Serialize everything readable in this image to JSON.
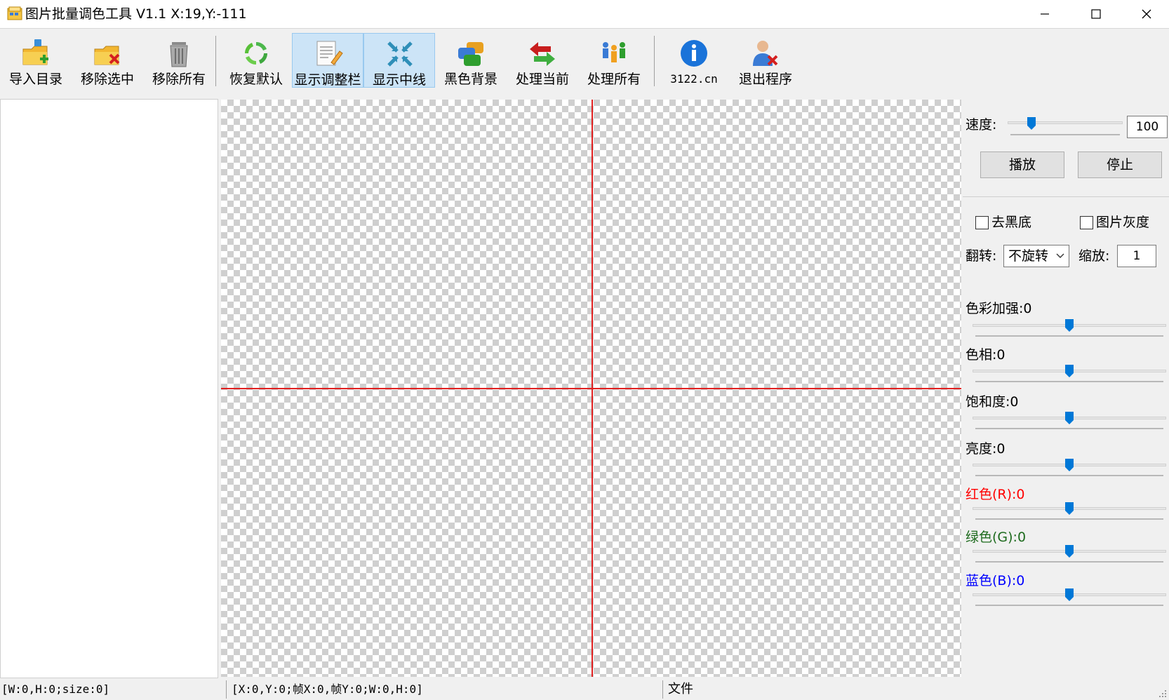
{
  "window": {
    "title": "图片批量调色工具 V1.1   X:19,Y:-111",
    "controls": {
      "minimize": "minimize",
      "maximize": "maximize",
      "close": "close"
    }
  },
  "toolbar": {
    "items": [
      {
        "label": "导入目录",
        "icon": "folder-add-icon",
        "active": false
      },
      {
        "label": "移除选中",
        "icon": "folder-remove-icon",
        "active": false
      },
      {
        "label": "移除所有",
        "icon": "trash-icon",
        "active": false
      },
      {
        "label": "恢复默认",
        "icon": "refresh-icon",
        "active": false
      },
      {
        "label": "显示调整栏",
        "icon": "edit-document-icon",
        "active": true
      },
      {
        "label": "显示中线",
        "icon": "center-arrows-icon",
        "active": true
      },
      {
        "label": "黑色背景",
        "icon": "layers-icon",
        "active": false
      },
      {
        "label": "处理当前",
        "icon": "swap-arrows-icon",
        "active": false
      },
      {
        "label": "处理所有",
        "icon": "people-icon",
        "active": false
      },
      {
        "label": "3122.cn",
        "icon": "info-icon",
        "active": false
      },
      {
        "label": "退出程序",
        "icon": "user-exit-icon",
        "active": false
      }
    ]
  },
  "panel": {
    "speed": {
      "label": "速度:",
      "value": "100",
      "level": 0.21
    },
    "play_button": "播放",
    "stop_button": "停止",
    "remove_black": {
      "label": "去黑底",
      "checked": false
    },
    "grayscale": {
      "label": "图片灰度",
      "checked": false
    },
    "flip": {
      "label": "翻转:",
      "selected": "不旋转"
    },
    "scale": {
      "label": "缩放:",
      "value": "1"
    },
    "sliders": [
      {
        "label": "色彩加强:0",
        "color": "#000000",
        "level": 0.5
      },
      {
        "label": "色相:0",
        "color": "#000000",
        "level": 0.5
      },
      {
        "label": "饱和度:0",
        "color": "#000000",
        "level": 0.5
      },
      {
        "label": "亮度:0",
        "color": "#000000",
        "level": 0.5
      },
      {
        "label": "红色(R):0",
        "color": "#ff0000",
        "level": 0.5
      },
      {
        "label": "绿色(G):0",
        "color": "#1e6b1e",
        "level": 0.5
      },
      {
        "label": "蓝色(B):0",
        "color": "#0000ff",
        "level": 0.5
      }
    ]
  },
  "statusbar": {
    "image_info": "[W:0,H:0;size:0]",
    "frame_info": "[X:0,Y:0;帧X:0,帧Y:0;W:0,H:0]",
    "file": "文件"
  },
  "colors": {
    "accent": "#0078d7",
    "guide_line": "#e02020",
    "active_button": "#cce4f7"
  }
}
